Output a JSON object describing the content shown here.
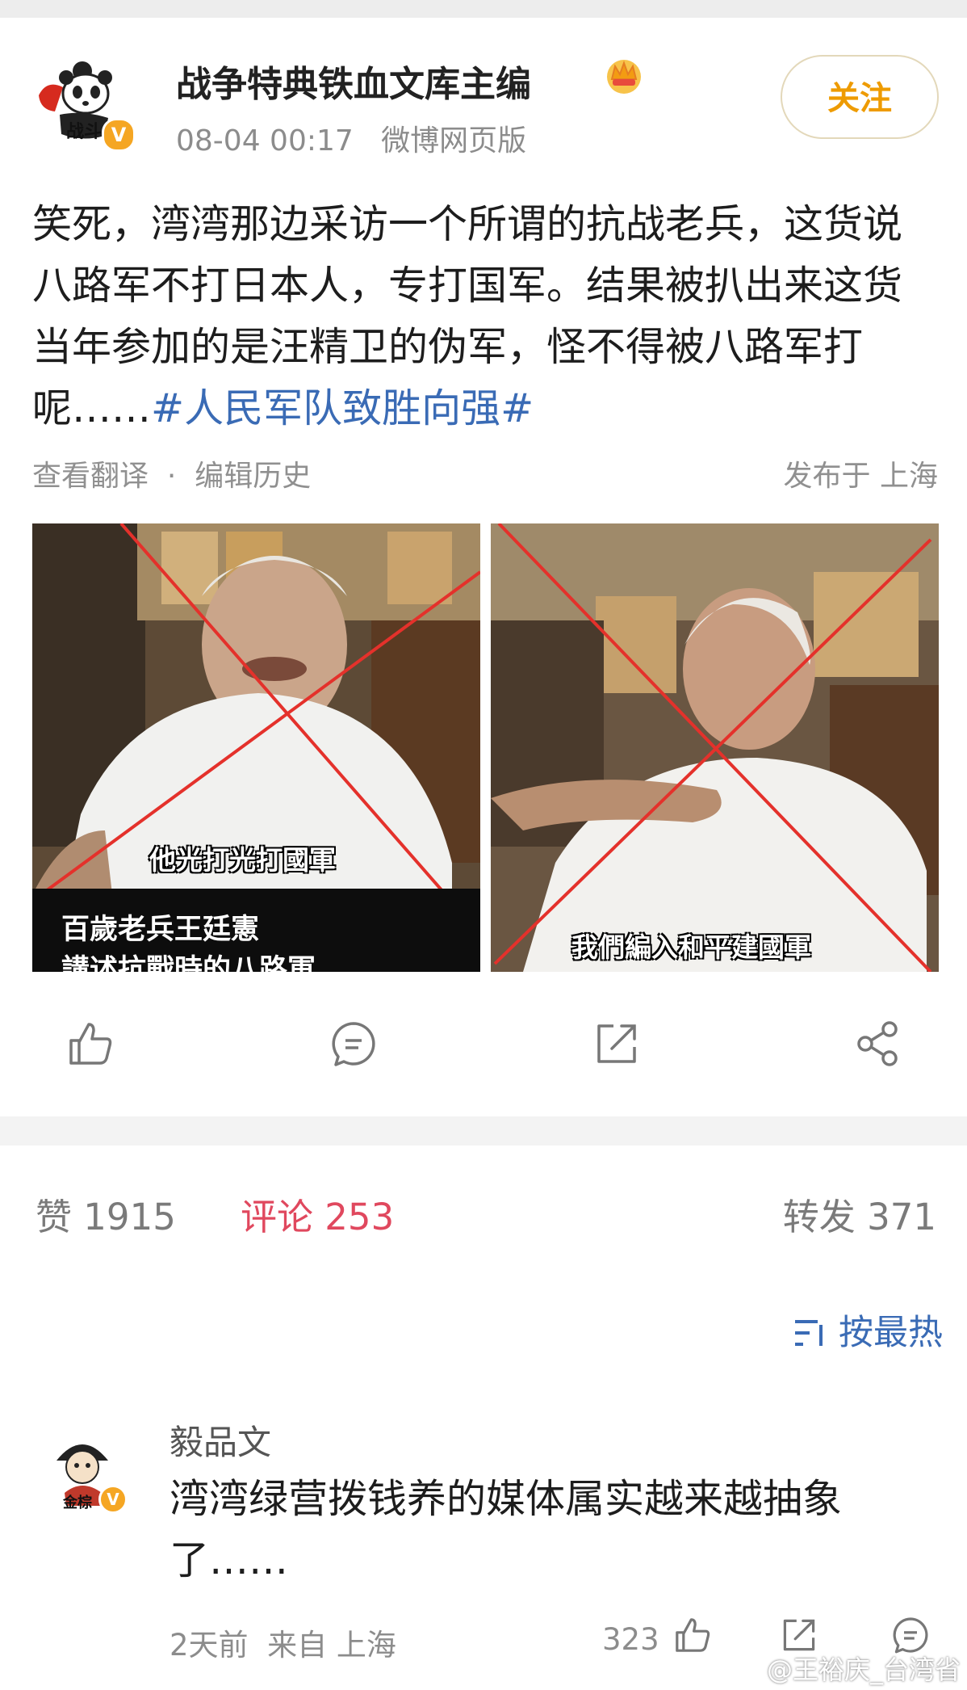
{
  "post": {
    "author": "战争特典铁血文库主编",
    "timestamp": "08-04 00:17",
    "source": "微博网页版",
    "follow_label": "关注",
    "verified_mark": "V",
    "text": "笑死，湾湾那边采访一个所谓的抗战老兵，这货说八路军不打日本人，专打国军。结果被扒出来这货当年参加的是汪精卫的伪军，怪不得被八路军打呢……",
    "hashtag": "#人民军队致胜向强#",
    "translate_label": "查看翻译",
    "separator": "·",
    "edit_history_label": "编辑历史",
    "location": "发布于 上海"
  },
  "images": [
    {
      "caption_top": "他光打光打國軍",
      "caption_line1": "百歲老兵王廷憲",
      "caption_line2": "講述抗戰時的八路軍"
    },
    {
      "caption_bottom": "我們編入和平建國軍"
    }
  ],
  "actions": [
    "like-icon",
    "comment-icon",
    "repost-icon",
    "share-icon"
  ],
  "stats": {
    "likes": "赞 1915",
    "comments": "评论 253",
    "reposts": "转发 371"
  },
  "sort": {
    "icon": "sort-icon",
    "label": "按最热"
  },
  "comment": {
    "user": "毅品文",
    "text": "湾湾绿营拨钱养的媒体属实越来越抽象了……",
    "time": "2天前",
    "from": "来自 上海",
    "likes": "323",
    "verified_mark": "V"
  },
  "watermark": "@王裕庆_台湾省",
  "colors": {
    "hashtag": "#3a6bb5",
    "follow": "#ee9b00",
    "active_tab": "#e0485e",
    "verified": "#f5a623"
  }
}
